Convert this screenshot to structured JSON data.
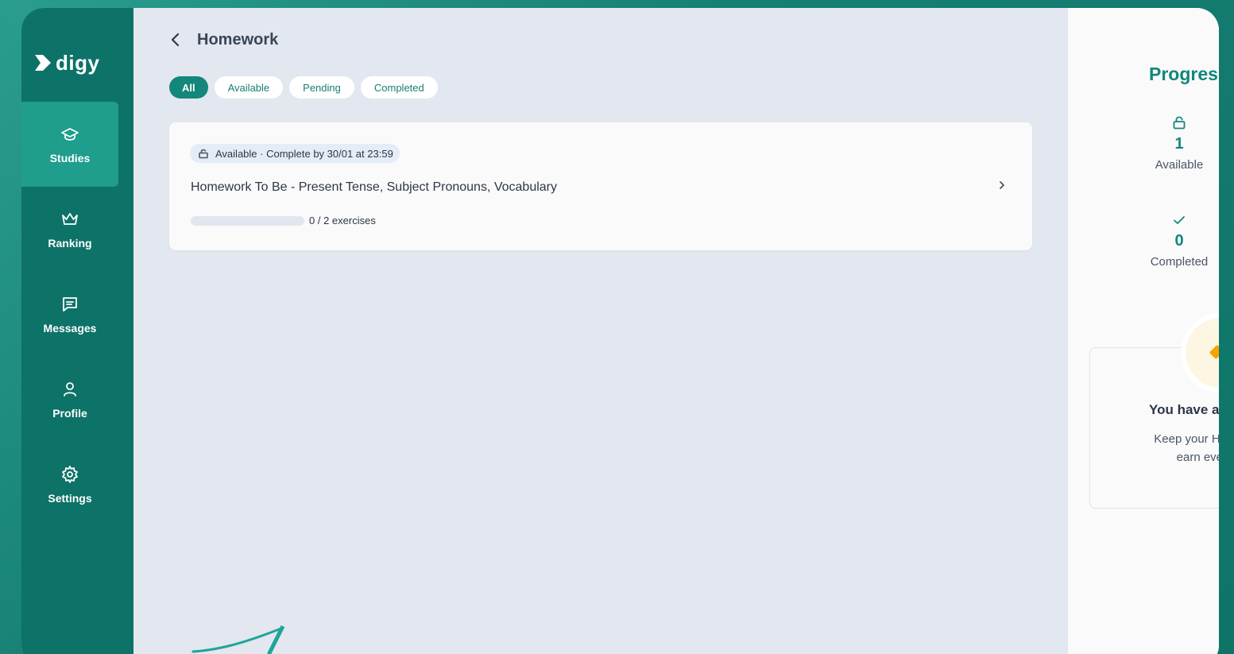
{
  "brand": {
    "name": "digy"
  },
  "sidebar": {
    "items": [
      {
        "label": "Studies",
        "icon": "graduation-cap-icon",
        "active": true
      },
      {
        "label": "Ranking",
        "icon": "crown-icon",
        "active": false
      },
      {
        "label": "Messages",
        "icon": "message-icon",
        "active": false
      },
      {
        "label": "Profile",
        "icon": "user-icon",
        "active": false
      },
      {
        "label": "Settings",
        "icon": "gear-icon",
        "active": false
      }
    ]
  },
  "header": {
    "title": "Homework"
  },
  "filters": [
    {
      "label": "All",
      "active": true
    },
    {
      "label": "Available",
      "active": false
    },
    {
      "label": "Pending",
      "active": false
    },
    {
      "label": "Completed",
      "active": false
    }
  ],
  "homework": [
    {
      "badge": "Available · Complete by 30/01 at 23:59",
      "title": "Homework To Be - Present Tense, Subject Pronouns, Vocabulary",
      "progress_text": "0 / 2 exercises",
      "progress": 0
    }
  ],
  "progress_panel": {
    "title": "Progress",
    "stats": [
      {
        "value": "1",
        "label": "Available",
        "icon": "lock-open-icon"
      },
      {
        "value": "0",
        "label": "Completed",
        "icon": "check-icon"
      }
    ],
    "promo": {
      "title": "You have a",
      "line1": "Keep your Homew",
      "line2": "earn even"
    }
  },
  "colors": {
    "accent": "#12877a",
    "sidebar": "#0d7268",
    "sidebar_active": "#1f9d8d"
  }
}
